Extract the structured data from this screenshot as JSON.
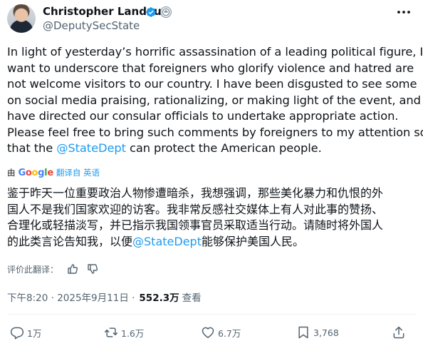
{
  "author": {
    "name": "Christopher Landau",
    "handle": "@DeputySecState"
  },
  "tweet": {
    "lines_en": [
      "In light of yesterday’s horrific assassination of a leading political figure, I",
      "want to underscore that foreigners who glorify violence and hatred are",
      "not welcome visitors to our country. I have been disgusted to see some",
      "on social media praising, rationalizing, or making light of the event, and",
      "have directed our consular officials to undertake appropriate action.",
      "Please feel free to bring such comments by foreigners to my attention so"
    ],
    "last_line_en": {
      "before": "that the ",
      "mention": "@StateDept",
      "after": " can protect the American people."
    }
  },
  "translation": {
    "by_label": "由",
    "google": [
      "G",
      "o",
      "o",
      "g",
      "l",
      "e"
    ],
    "source_label": "翻译自 英语",
    "lines_zh": [
      "鉴于昨天一位重要政治人物惨遭暗杀，我想强调，那些美化暴力和仇恨的外",
      "国人不是我们国家欢迎的访客。我非常反感社交媒体上有人对此事的赞扬、",
      "合理化或轻描淡写，并已指示我国领事官员采取适当行动。请随时将外国人"
    ],
    "last_line_zh": {
      "before": "的此类言论告知我，以便",
      "mention": "@StateDept",
      "after": "能够保护美国人民。"
    },
    "rate_label": "评价此翻译："
  },
  "meta": {
    "time": "下午8:20 · 2025年9月11日 ·",
    "views_count": "552.3万",
    "views_label": "查看"
  },
  "actions": {
    "replies": "1万",
    "reposts": "1.6万",
    "likes": "6.7万",
    "bookmarks": "3,768"
  },
  "colors": {
    "accent": "#1d9bf0",
    "verified": "#1d9bf0",
    "text": "#0f1419",
    "secondary": "#536471"
  }
}
